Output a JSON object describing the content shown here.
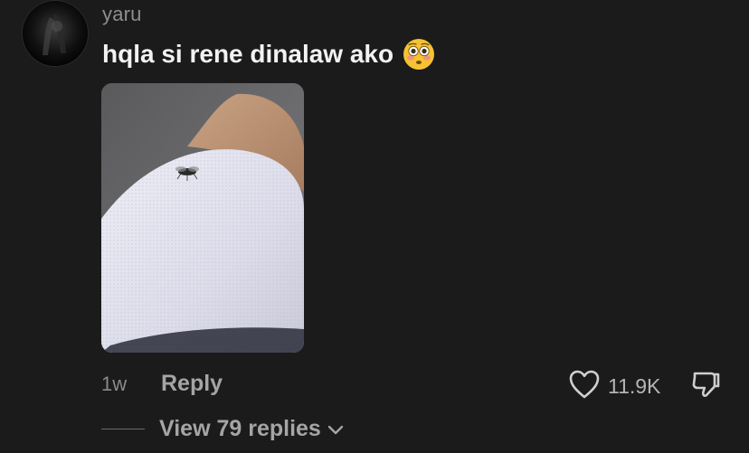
{
  "comment": {
    "username": "yaru",
    "text": "hqla si rene dinalaw ako",
    "emoji_icon": "flushed-face-emoji",
    "timestamp": "1w",
    "reply_label": "Reply",
    "like_count": "11.9K",
    "view_replies_label": "View 79 replies"
  },
  "colors": {
    "background": "#1b1b1b",
    "text_primary": "#f2f2f2",
    "text_secondary": "#8e8e8e",
    "emoji_face": "#f5c232"
  }
}
